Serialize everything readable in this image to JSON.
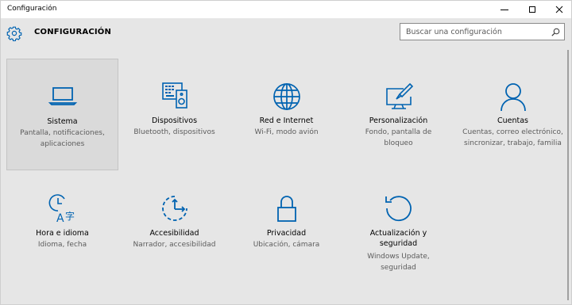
{
  "window": {
    "title": "Configuración"
  },
  "header": {
    "title": "CONFIGURACIÓN"
  },
  "search": {
    "placeholder": "Buscar una configuración"
  },
  "colors": {
    "accent": "#0063b1",
    "background": "#e6e6e6",
    "selected_tile": "#dadada"
  },
  "tiles": [
    {
      "icon": "laptop-icon",
      "title": "Sistema",
      "description": "Pantalla, notificaciones, aplicaciones"
    },
    {
      "icon": "devices-icon",
      "title": "Dispositivos",
      "description": "Bluetooth, dispositivos"
    },
    {
      "icon": "globe-icon",
      "title": "Red e Internet",
      "description": "Wi-Fi, modo avión"
    },
    {
      "icon": "personalization-icon",
      "title": "Personalización",
      "description": "Fondo, pantalla de bloqueo"
    },
    {
      "icon": "person-icon",
      "title": "Cuentas",
      "description": "Cuentas, correo electrónico, sincronizar, trabajo, familia"
    },
    {
      "icon": "time-language-icon",
      "title": "Hora e idioma",
      "description": "Idioma, fecha"
    },
    {
      "icon": "accessibility-icon",
      "title": "Accesibilidad",
      "description": "Narrador, accesibilidad"
    },
    {
      "icon": "lock-icon",
      "title": "Privacidad",
      "description": "Ubicación, cámara"
    },
    {
      "icon": "update-icon",
      "title": "Actualización y seguridad",
      "description": "Windows Update, seguridad"
    }
  ]
}
